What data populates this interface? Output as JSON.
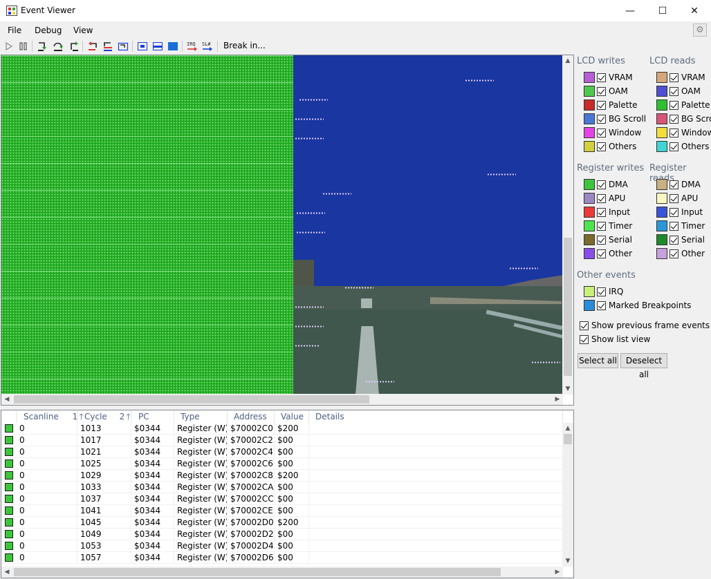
{
  "window": {
    "title": "Event Viewer",
    "min_glyph": "—",
    "max_glyph": "☐",
    "close_glyph": "✕"
  },
  "menu": {
    "file": "File",
    "debug": "Debug",
    "view": "View"
  },
  "toolbar": {
    "break_in": "Break in...",
    "irq_label": "IRQ",
    "sl_label": "SL#"
  },
  "panel": {
    "lcd_writes": {
      "title": "LCD writes",
      "items": [
        {
          "label": "VRAM",
          "color": "#b65fd6"
        },
        {
          "label": "OAM",
          "color": "#4fc84f"
        },
        {
          "label": "Palette",
          "color": "#c92a2a"
        },
        {
          "label": "BG Scroll",
          "color": "#4a78d4"
        },
        {
          "label": "Window",
          "color": "#e444e4"
        },
        {
          "label": "Others",
          "color": "#d0d040"
        }
      ]
    },
    "lcd_reads": {
      "title": "LCD reads",
      "items": [
        {
          "label": "VRAM",
          "color": "#d4a87a"
        },
        {
          "label": "OAM",
          "color": "#4f4fd4"
        },
        {
          "label": "Palette",
          "color": "#2ec02e"
        },
        {
          "label": "BG Scroll",
          "color": "#d85577"
        },
        {
          "label": "Window",
          "color": "#f2de3a"
        },
        {
          "label": "Others",
          "color": "#40d4d4"
        }
      ]
    },
    "register_writes": {
      "title": "Register writes",
      "items": [
        {
          "label": "DMA",
          "color": "#3ec43e"
        },
        {
          "label": "APU",
          "color": "#9d87c2"
        },
        {
          "label": "Input",
          "color": "#ec3a3a"
        },
        {
          "label": "Timer",
          "color": "#4fe44f"
        },
        {
          "label": "Serial",
          "color": "#7a6a2c"
        },
        {
          "label": "Other",
          "color": "#8a4ee8"
        }
      ]
    },
    "register_reads": {
      "title": "Register reads",
      "items": [
        {
          "label": "DMA",
          "color": "#c8b080"
        },
        {
          "label": "APU",
          "color": "#fbf6c2"
        },
        {
          "label": "Input",
          "color": "#3a54d8"
        },
        {
          "label": "Timer",
          "color": "#2a98d8"
        },
        {
          "label": "Serial",
          "color": "#1e8a2a"
        },
        {
          "label": "Other",
          "color": "#c8a0dc"
        }
      ]
    },
    "other_events": {
      "title": "Other events",
      "items": [
        {
          "label": "IRQ",
          "color": "#c8f07a"
        },
        {
          "label": "Marked Breakpoints",
          "color": "#2a8cd8"
        }
      ]
    },
    "show_previous": "Show previous frame events",
    "show_list": "Show list view",
    "select_all": "Select all",
    "deselect_all": "Deselect all"
  },
  "list": {
    "columns": [
      "",
      "Scanline",
      "Cycle",
      "PC",
      "Type",
      "Address",
      "Value",
      "Details"
    ],
    "sort_scanline": "1",
    "sort_cycle": "2",
    "rows": [
      [
        "0",
        "1013",
        "$0344",
        "Register (W)",
        "$70002C0",
        "$200"
      ],
      [
        "0",
        "1017",
        "$0344",
        "Register (W)",
        "$70002C2",
        "$00"
      ],
      [
        "0",
        "1021",
        "$0344",
        "Register (W)",
        "$70002C4",
        "$00"
      ],
      [
        "0",
        "1025",
        "$0344",
        "Register (W)",
        "$70002C6",
        "$00"
      ],
      [
        "0",
        "1029",
        "$0344",
        "Register (W)",
        "$70002C8",
        "$200"
      ],
      [
        "0",
        "1033",
        "$0344",
        "Register (W)",
        "$70002CA",
        "$00"
      ],
      [
        "0",
        "1037",
        "$0344",
        "Register (W)",
        "$70002CC",
        "$00"
      ],
      [
        "0",
        "1041",
        "$0344",
        "Register (W)",
        "$70002CE",
        "$00"
      ],
      [
        "0",
        "1045",
        "$0344",
        "Register (W)",
        "$70002D0",
        "$200"
      ],
      [
        "0",
        "1049",
        "$0344",
        "Register (W)",
        "$70002D2",
        "$00"
      ],
      [
        "0",
        "1053",
        "$0344",
        "Register (W)",
        "$70002D4",
        "$00"
      ],
      [
        "0",
        "1057",
        "$0344",
        "Register (W)",
        "$70002D6",
        "$00"
      ]
    ]
  }
}
